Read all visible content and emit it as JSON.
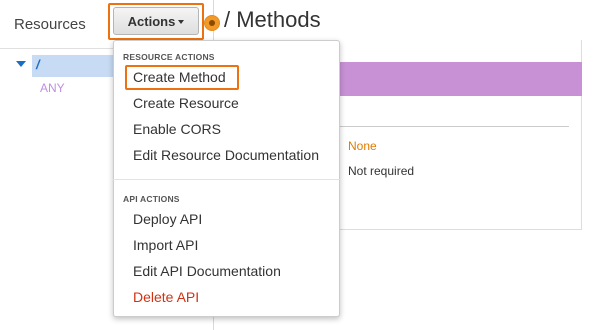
{
  "sidebar": {
    "title": "Resources",
    "tree": {
      "root_label": "/",
      "child_label": "ANY"
    }
  },
  "toolbar": {
    "actions_label": "Actions"
  },
  "page": {
    "title": "/ Methods"
  },
  "main": {
    "auth_value": "None",
    "api_key_value": "Not required"
  },
  "menu": {
    "resource_heading": "RESOURCE ACTIONS",
    "resource_items": [
      "Create Method",
      "Create Resource",
      "Enable CORS",
      "Edit Resource Documentation"
    ],
    "api_heading": "API ACTIONS",
    "api_items": [
      "Deploy API",
      "Import API",
      "Edit API Documentation",
      "Delete API"
    ]
  },
  "colors": {
    "highlight": "#ec7211",
    "method_header": "#c891d6",
    "selected_row": "#c7dcf4",
    "danger": "#d13212"
  },
  "icons": {
    "tree_toggle": "caret-down-icon",
    "marker": "orange-dot-marker-icon"
  }
}
